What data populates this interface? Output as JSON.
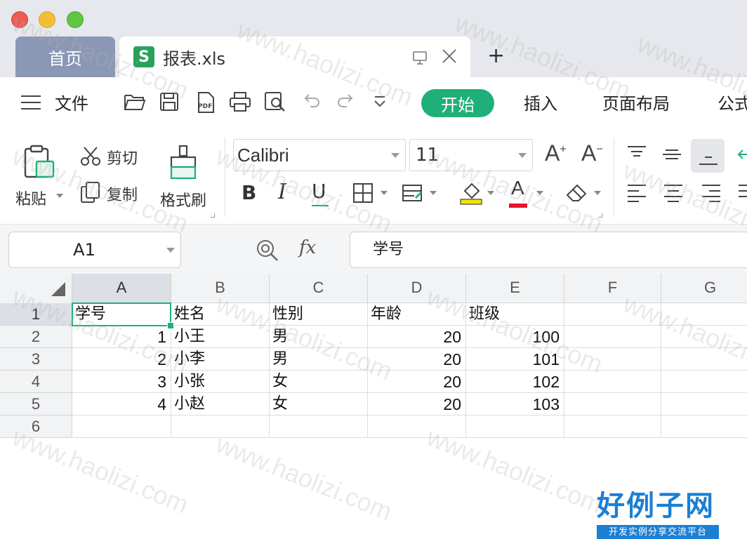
{
  "tabs": {
    "home_label": "首页",
    "file_icon_letter": "S",
    "file_name": "报表.xls",
    "add_label": "+"
  },
  "menu": {
    "file_label": "文件",
    "items": [
      "开始",
      "插入",
      "页面布局",
      "公式"
    ]
  },
  "ribbon": {
    "paste_label": "粘贴",
    "cut_label": "剪切",
    "copy_label": "复制",
    "format_painter_label": "格式刷",
    "font_name": "Calibri",
    "font_size": "11",
    "bold_label": "B",
    "italic_label": "I",
    "underline_label": "U",
    "grow_font_label": "A",
    "shrink_font_label": "A",
    "font_color_label": "A",
    "font_color": "#e8122a",
    "highlight_color": "#f3e600"
  },
  "formula_bar": {
    "cell_ref": "A1",
    "fx_label": "fx",
    "value": "学号"
  },
  "sheet": {
    "columns": [
      "A",
      "B",
      "C",
      "D",
      "E",
      "F",
      "G"
    ],
    "row_numbers": [
      "1",
      "2",
      "3",
      "4",
      "5",
      "6"
    ],
    "header_row": [
      "学号",
      "姓名",
      "性别",
      "年龄",
      "班级"
    ],
    "rows": [
      [
        "1",
        "小王",
        "男",
        "20",
        "100"
      ],
      [
        "2",
        "小李",
        "男",
        "20",
        "101"
      ],
      [
        "3",
        "小张",
        "女",
        "20",
        "102"
      ],
      [
        "4",
        "小赵",
        "女",
        "20",
        "103"
      ]
    ],
    "selected_cell": "A1"
  },
  "watermark": {
    "text": "www.haolizi.com",
    "logo_main": "好例子网",
    "logo_sub": "开发实例分享交流平台"
  },
  "colors": {
    "accent": "#1fb079",
    "tab_inactive": "#8a97b5",
    "logo_blue": "#1b7fd4"
  }
}
